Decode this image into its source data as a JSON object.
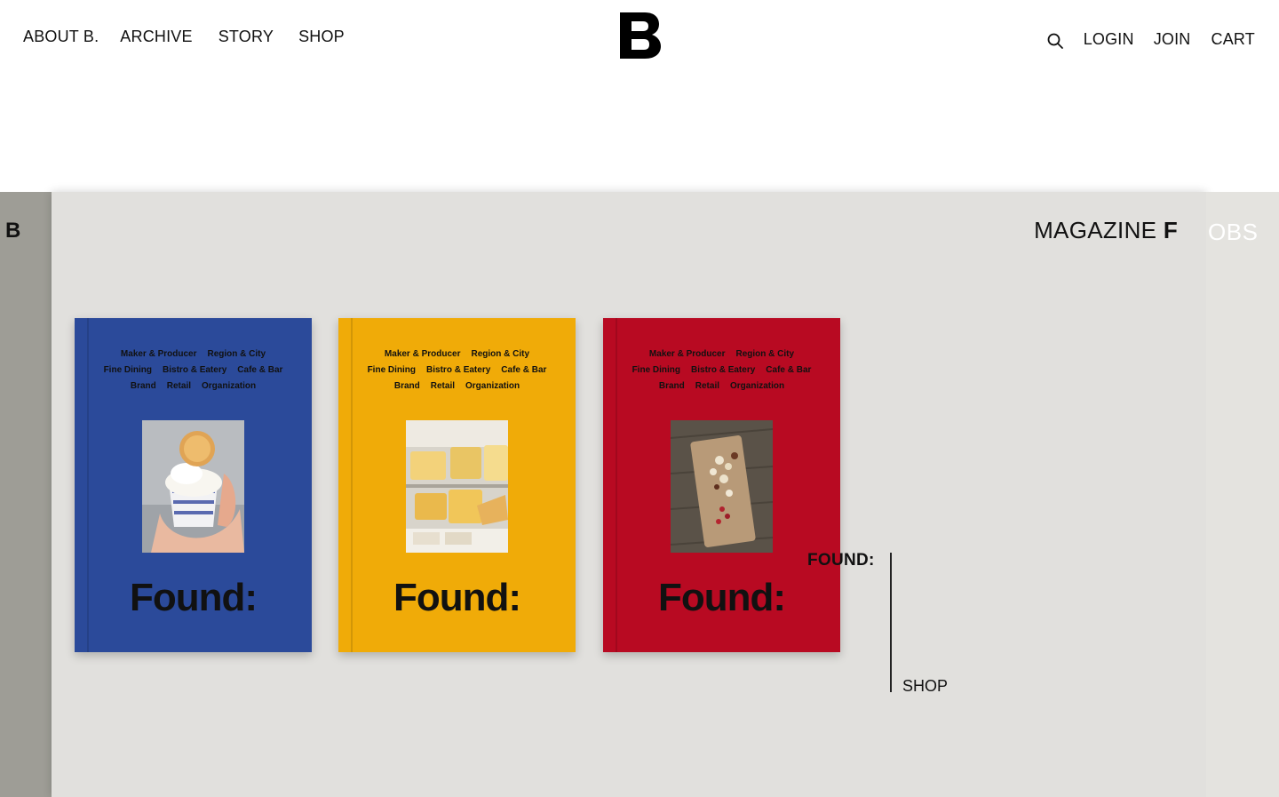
{
  "header": {
    "nav_left": [
      "ABOUT B.",
      "ARCHIVE",
      "STORY",
      "SHOP"
    ],
    "logo": "B",
    "nav_right": {
      "search_icon": "search-icon",
      "login": "LOGIN",
      "join": "JOIN",
      "cart": "CART"
    }
  },
  "slider": {
    "left_panel_letter": "B",
    "main_title_regular": "MAGAZINE ",
    "main_title_bold": "F",
    "right_panel_label": "OBS",
    "magazines": [
      {
        "color": "#2b4a9a",
        "categories": [
          [
            "Maker & Producer",
            "Region & City"
          ],
          [
            "Fine Dining",
            "Bistro & Eatery",
            "Cafe & Bar"
          ],
          [
            "Brand",
            "Retail",
            "Organization"
          ]
        ],
        "title": "Found:"
      },
      {
        "color": "#f0ab08",
        "categories": [
          [
            "Maker & Producer",
            "Region & City"
          ],
          [
            "Fine Dining",
            "Bistro & Eatery",
            "Cafe & Bar"
          ],
          [
            "Brand",
            "Retail",
            "Organization"
          ]
        ],
        "title": "Found:"
      },
      {
        "color": "#b80a22",
        "categories": [
          [
            "Maker & Producer",
            "Region & City"
          ],
          [
            "Fine Dining",
            "Bistro & Eatery",
            "Cafe & Bar"
          ],
          [
            "Brand",
            "Retail",
            "Organization"
          ]
        ],
        "title": "Found:"
      }
    ],
    "found_label": "FOUND:",
    "shop_link": "SHOP"
  }
}
